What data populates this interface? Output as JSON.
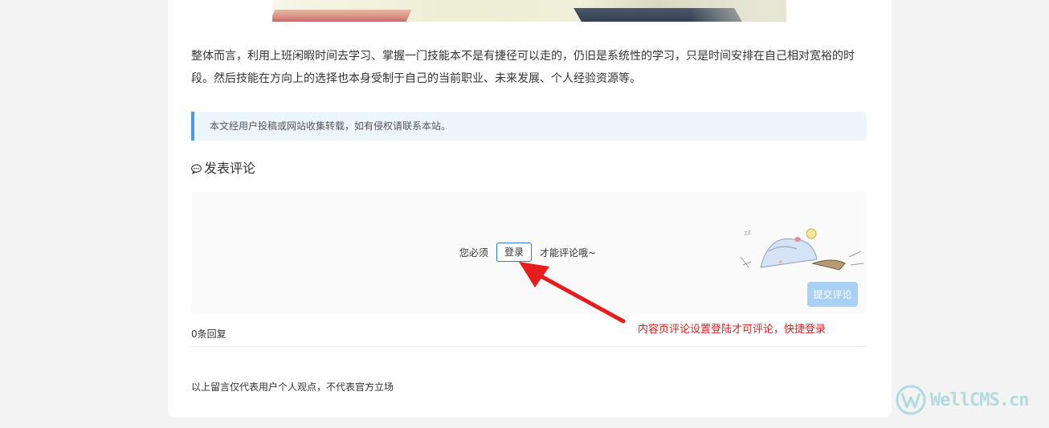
{
  "article": {
    "paragraph": "整体而言，利用上班闲暇时间去学习、掌握一门技能本不是有捷径可以走的，仍旧是系统性的学习，只是时间安排在自己相对宽裕的时段。然后技能在方向上的选择也本身受制于自己的当前职业、未来发展、个人经验资源等。"
  },
  "notice": {
    "text": "本文经用户投稿或网站收集转载，如有侵权请联系本站。"
  },
  "comments": {
    "heading": "发表评论",
    "heading_icon": "speech-bubble-icon",
    "login_prefix": "您必须",
    "login_button": "登录",
    "login_suffix": "才能评论哦~",
    "submit_button": "提交评论",
    "mascot_icon": "sleeping-mascot-icon",
    "reply_count": "0条回复",
    "disclaimer": "以上留言仅代表用户个人观点，不代表官方立场"
  },
  "annotation": {
    "text": "内容页评论设置登陆才可评论，快捷登录",
    "color": "#e02020",
    "arrow_icon": "red-arrow-icon"
  },
  "watermark": {
    "text": "WellCMS.cn",
    "logo_icon": "w-logo-icon"
  },
  "colors": {
    "accent": "#2a7bd1",
    "notice_border": "#4a9be4",
    "notice_bg": "#edf5fd",
    "submit_disabled": "#a9d1f5"
  }
}
